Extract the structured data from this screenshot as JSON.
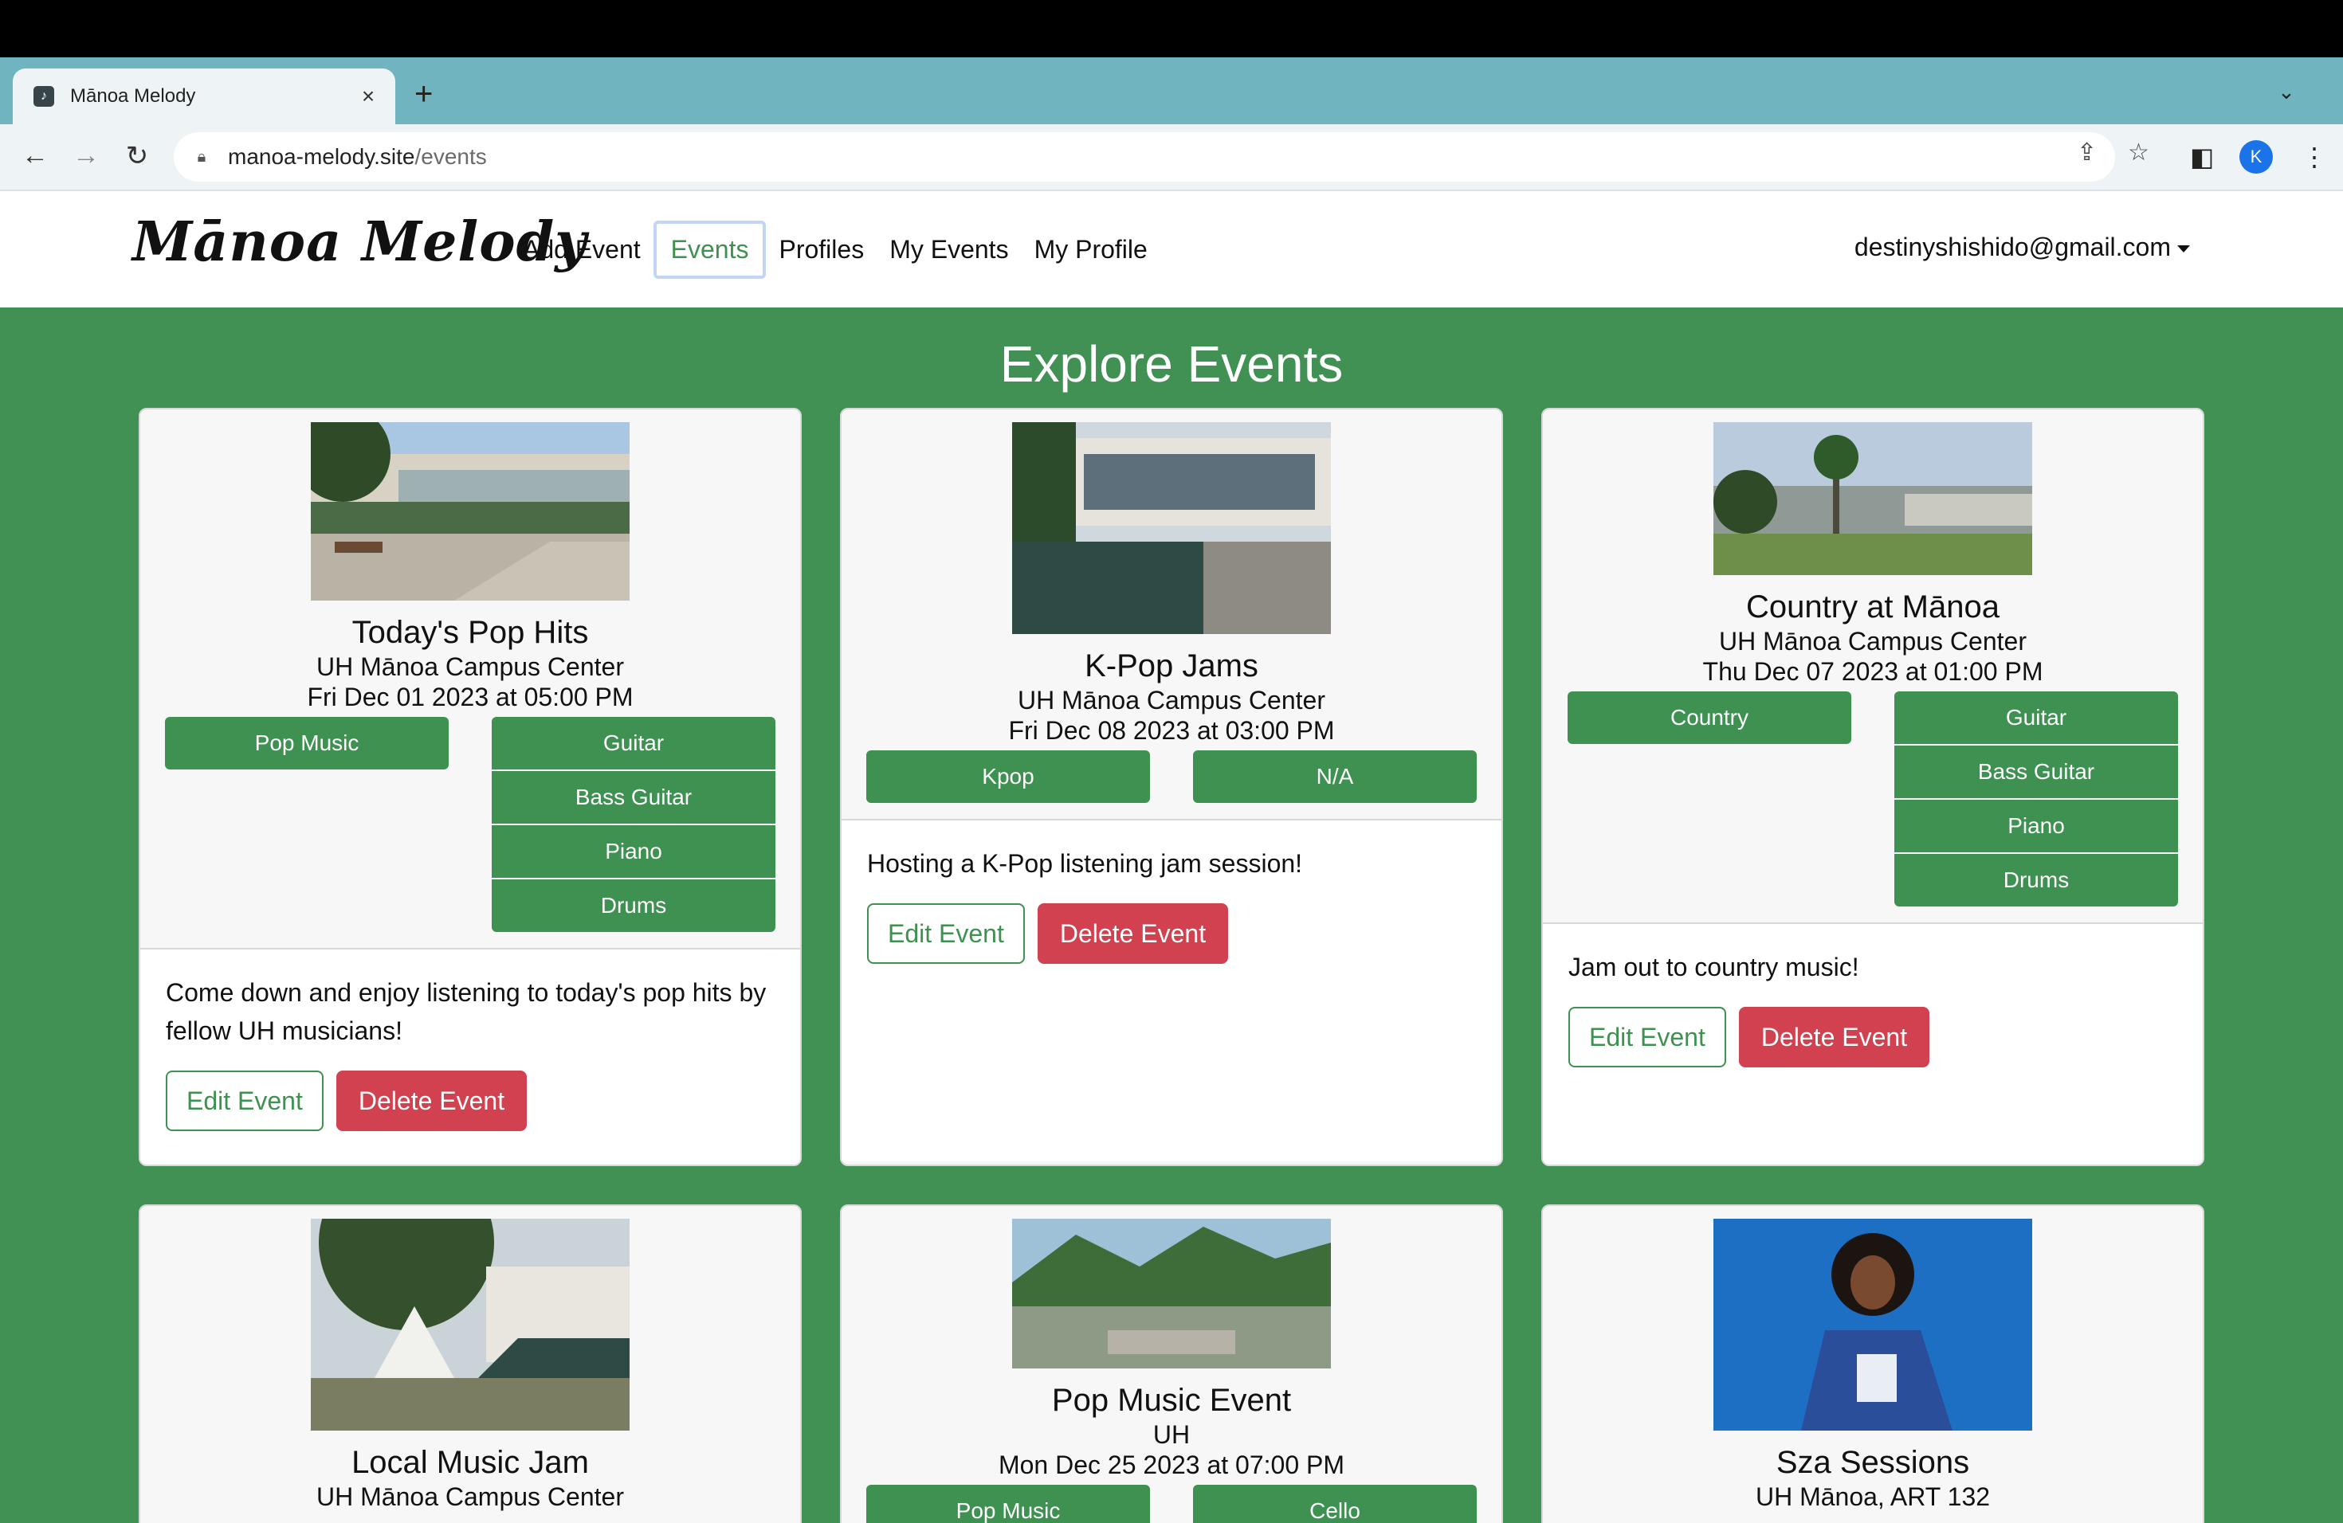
{
  "browser": {
    "tab_title": "Mānoa Melody",
    "tab_close": "×",
    "new_tab": "+",
    "url_host": "manoa-melody.site",
    "url_path": "/events",
    "profile_initial": "K"
  },
  "navbar": {
    "brand": "Mānoa Melody",
    "links": [
      "Add Event",
      "Events",
      "Profiles",
      "My Events",
      "My Profile"
    ],
    "active_link": "Events",
    "user_email": "destinyshishido@gmail.com"
  },
  "page": {
    "title": "Explore Events"
  },
  "colors": {
    "page_green": "#409153",
    "tag_green": "#3e9150",
    "delete_red": "#d1414f",
    "tabstrip_teal": "#6fb4bf"
  },
  "events": [
    {
      "title": "Today's Pop Hits",
      "location": "UH Mānoa Campus Center",
      "date": "Fri Dec 01 2023 at 05:00 PM",
      "genre_tags": [
        "Pop Music"
      ],
      "instrument_tags": [
        "Guitar",
        "Bass Guitar",
        "Piano",
        "Drums"
      ],
      "description": "Come down and enjoy listening to today's pop hits by fellow UH musicians!",
      "edit_label": "Edit Event",
      "delete_label": "Delete Event",
      "image": "campus-center-plaza"
    },
    {
      "title": "K-Pop Jams",
      "location": "UH Mānoa Campus Center",
      "date": "Fri Dec 08 2023 at 03:00 PM",
      "genre_tags": [
        "Kpop"
      ],
      "instrument_tags": [
        "N/A"
      ],
      "description": "Hosting a K-Pop listening jam session!",
      "edit_label": "Edit Event",
      "delete_label": "Delete Event",
      "image": "campus-center-stairs"
    },
    {
      "title": "Country at Mānoa",
      "location": "UH Mānoa Campus Center",
      "date": "Thu Dec 07 2023 at 01:00 PM",
      "genre_tags": [
        "Country"
      ],
      "instrument_tags": [
        "Guitar",
        "Bass Guitar",
        "Piano",
        "Drums"
      ],
      "description": "Jam out to country music!",
      "edit_label": "Edit Event",
      "delete_label": "Delete Event",
      "image": "campus-lawn-palms"
    },
    {
      "title": "Local Music Jam",
      "location": "UH Mānoa Campus Center",
      "image": "campus-center-tent"
    },
    {
      "title": "Pop Music Event",
      "location": "UH",
      "date": "Mon Dec 25 2023 at 07:00 PM",
      "genre_tags": [
        "Pop Music"
      ],
      "instrument_tags": [
        "Cello"
      ],
      "image": "manoa-valley-aerial"
    },
    {
      "title": "Sza Sessions",
      "location": "UH Mānoa, ART 132",
      "image": "singer-on-stage"
    }
  ]
}
